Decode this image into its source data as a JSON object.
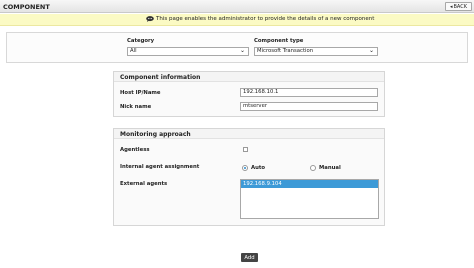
{
  "header": {
    "title": "COMPONENT",
    "back_label": "BACK"
  },
  "info": {
    "message": "This page enables the administrator to provide the details of a new component"
  },
  "selectors": {
    "category_label": "Category",
    "category_value": "All",
    "component_type_label": "Component type",
    "component_type_value": "Microsoft Transaction"
  },
  "component_info": {
    "legend": "Component information",
    "host_label": "Host IP/Name",
    "host_value": "192.168.10.1",
    "nick_label": "Nick name",
    "nick_value": "mtserver"
  },
  "monitoring": {
    "legend": "Monitoring approach",
    "agentless_label": "Agentless",
    "agentless_checked": false,
    "assignment_label": "Internal agent assignment",
    "assignment_options": [
      "Auto",
      "Manual"
    ],
    "assignment_selected": "Auto",
    "external_agents_label": "External agents",
    "external_agents": [
      "192.168.9.104"
    ]
  },
  "footer": {
    "add_label": "Add"
  }
}
